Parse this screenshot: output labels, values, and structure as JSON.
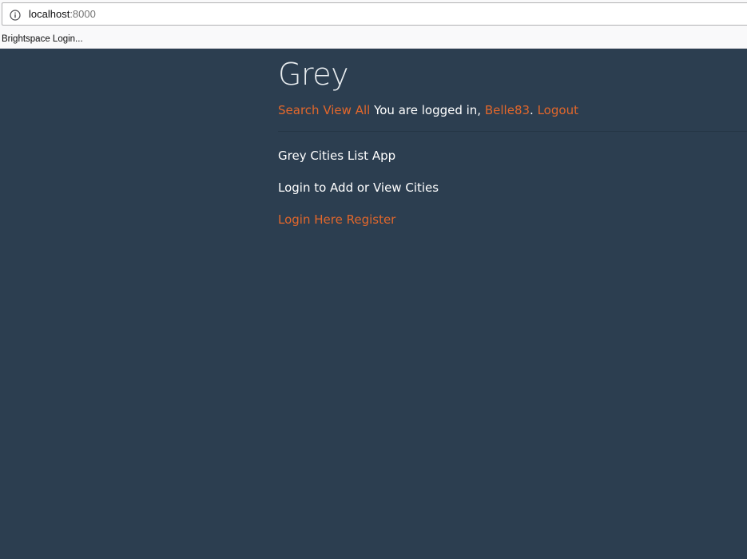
{
  "browser": {
    "url_host": "localhost",
    "url_port": ":8000",
    "bookmark": "Brightspace Login..."
  },
  "site": {
    "title": "Grey"
  },
  "nav": {
    "search": "Search",
    "view_all": "View All",
    "logged_in_text": "You are logged in,",
    "username": "Belle83",
    "period": ".",
    "logout": "Logout"
  },
  "content": {
    "line1": "Grey Cities List App",
    "line2": "Login to Add or View Cities",
    "login_link": "Login Here",
    "register_link": "Register"
  },
  "colors": {
    "page_bg": "#2c3e50",
    "link": "#e2672b",
    "text": "#ffffff"
  }
}
